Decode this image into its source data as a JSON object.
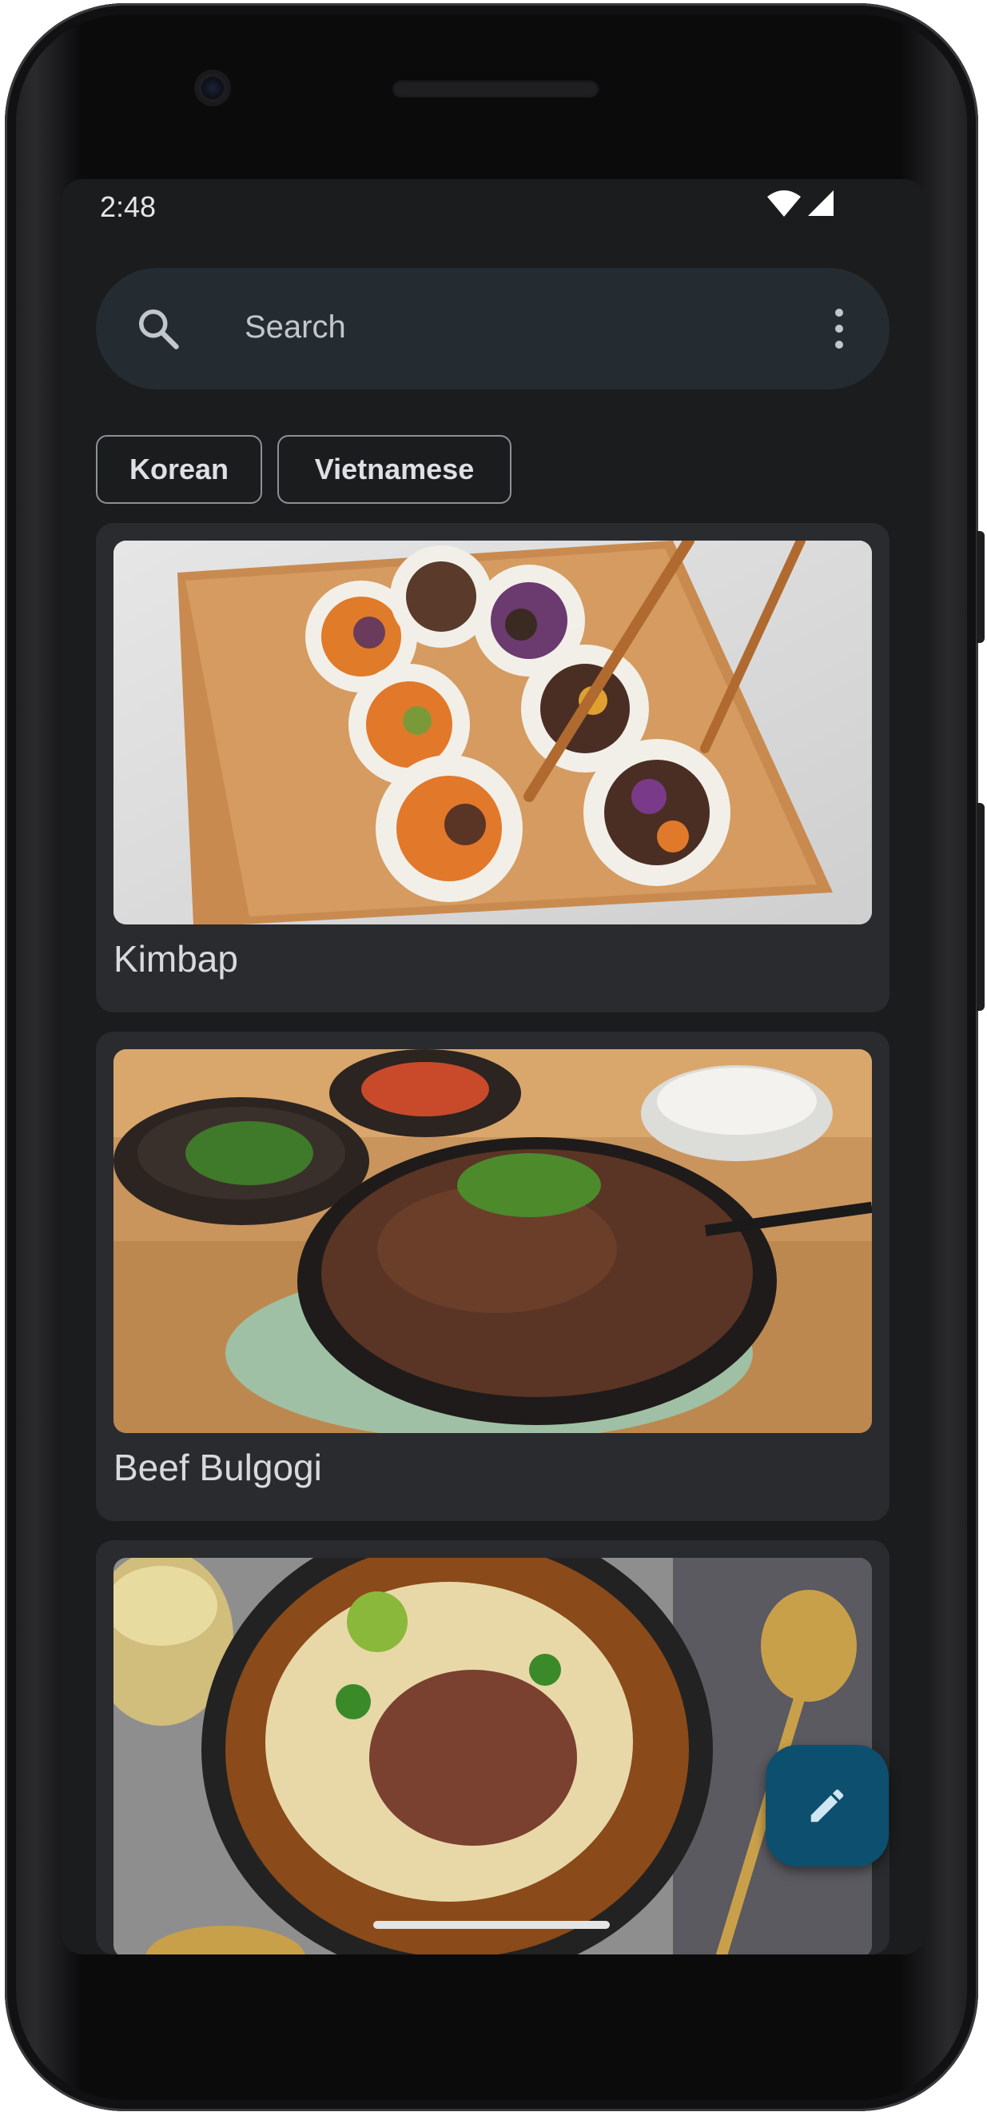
{
  "status_bar": {
    "time": "2:48",
    "icons": [
      "wifi-icon",
      "cellular-signal-icon"
    ]
  },
  "search": {
    "placeholder": "Search",
    "icon": "search-icon",
    "menu_icon": "more-vert-icon"
  },
  "filters": {
    "chips": [
      {
        "label": "Korean"
      },
      {
        "label": "Vietnamese"
      }
    ]
  },
  "recipes": [
    {
      "title": "Kimbap",
      "image": "kimbap-photo"
    },
    {
      "title": "Beef Bulgogi",
      "image": "bulgogi-photo"
    },
    {
      "title": "",
      "image": "pho-photo"
    }
  ],
  "fab": {
    "icon": "edit-pencil-icon"
  },
  "colors": {
    "background": "#1b1c1e",
    "search_bar": "#242c32",
    "card": "#2a2b2e",
    "fab": "#0d4f6e"
  }
}
